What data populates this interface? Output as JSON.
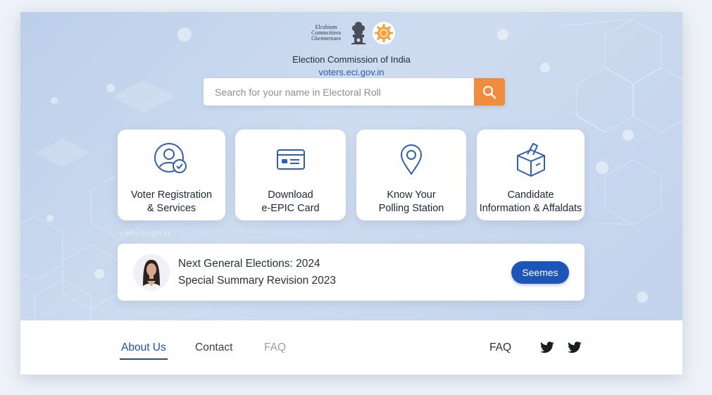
{
  "header": {
    "logo_text": [
      "Elcubium",
      "Commcitiera",
      "Gkennernaes"
    ],
    "title": "Election Commission of India",
    "url": "voters.eci.gov.in"
  },
  "search": {
    "placeholder": "Search for your name in Electoral Roll",
    "icon": "search-icon"
  },
  "services": [
    {
      "label": "Voter Registration\n& Services",
      "icon": "user-check-icon"
    },
    {
      "label": "Download\ne-EPIC Card",
      "icon": "id-card-icon"
    },
    {
      "label": "Know Your\nPolling Station",
      "icon": "location-pin-icon"
    },
    {
      "label": "Candidate\nInformation & Affaldats",
      "icon": "ballot-box-icon"
    }
  ],
  "watermark_url": "voters.eci.gov.in",
  "notice": {
    "line1": "Next General Elections: 2024",
    "line2": "Special Summary Revision 2023",
    "button_label": "Seemes"
  },
  "footer": {
    "links": [
      "About Us",
      "Contact",
      "FAQ"
    ],
    "right_link": "FAQ",
    "social_icons": [
      "twitter-icon",
      "twitter-icon"
    ]
  },
  "colors": {
    "accent": "#1b55b8",
    "search_button": "#f08c3e",
    "link_active": "#1e4f9e"
  }
}
